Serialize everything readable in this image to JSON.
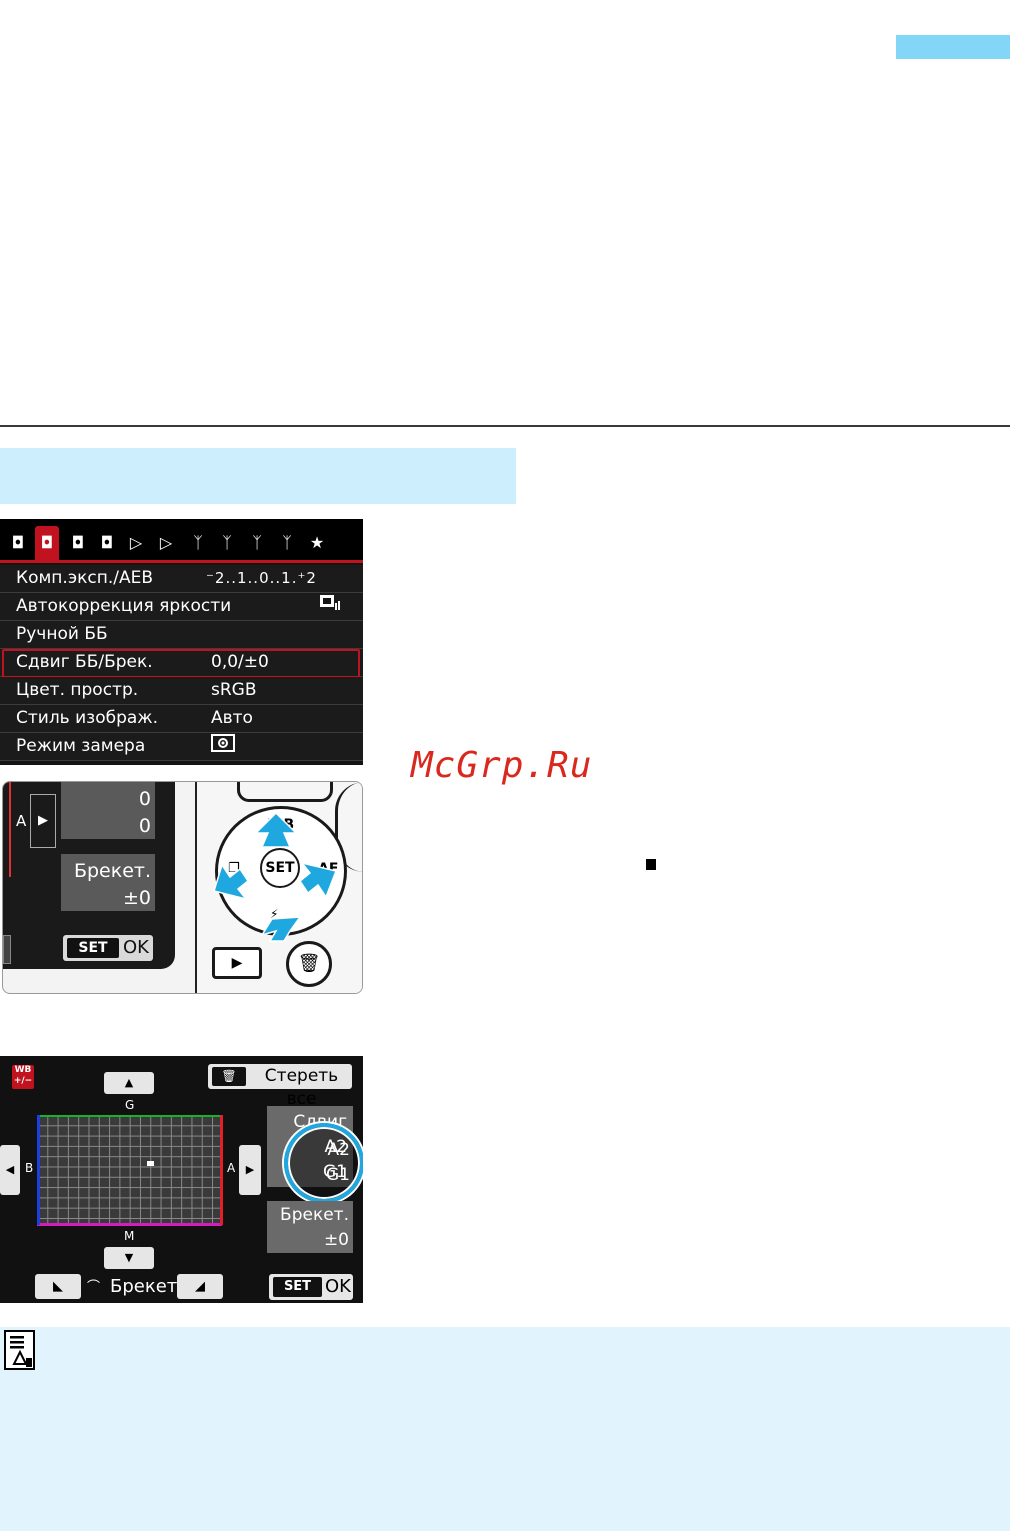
{
  "watermark": "McGrp.Ru",
  "menu": {
    "tabs": [
      "camera-1",
      "camera-2",
      "camera-3",
      "camera-4",
      "play-1",
      "play-2",
      "wrench-1",
      "wrench-2",
      "wrench-3",
      "wrench-4",
      "star"
    ],
    "rows": [
      {
        "label": "Комп.эксп./AEB",
        "value": "⁻2..1..0..1.⁺2"
      },
      {
        "label": "Автокоррекция яркости",
        "value": ""
      },
      {
        "label": "Ручной ББ",
        "value": ""
      },
      {
        "label": "Сдвиг ББ/Брек.",
        "value": "0,0/±0"
      },
      {
        "label": "Цвет. простр.",
        "value": "sRGB"
      },
      {
        "label": "Стиль изображ.",
        "value": "Авто"
      },
      {
        "label": "Режим замера",
        "value": ""
      }
    ],
    "selected_index": 3
  },
  "camera": {
    "lcd_a": "A",
    "lcd_val1": "0",
    "lcd_val2": "0",
    "lcd_bracket": "Брекет.",
    "lcd_bracket_val": "±0",
    "lcd_set": "SET",
    "lcd_ok": "OK",
    "btn_wb": "WB",
    "btn_af": "AF",
    "btn_set": "SET"
  },
  "wb": {
    "badge_top": "WB",
    "badge_bottom": "+/−",
    "clear_all": "Стереть все",
    "g": "G",
    "m": "M",
    "b": "B",
    "a": "A",
    "shift_label": "Сдвиг",
    "shift_a": "A2",
    "shift_g": "G1",
    "bracket_label": "Брекет.",
    "bracket_val": "±0",
    "bracket_dial": "Брекет.",
    "set": "SET",
    "ok": "OK",
    "point": {
      "a": 2,
      "g": 1
    }
  }
}
